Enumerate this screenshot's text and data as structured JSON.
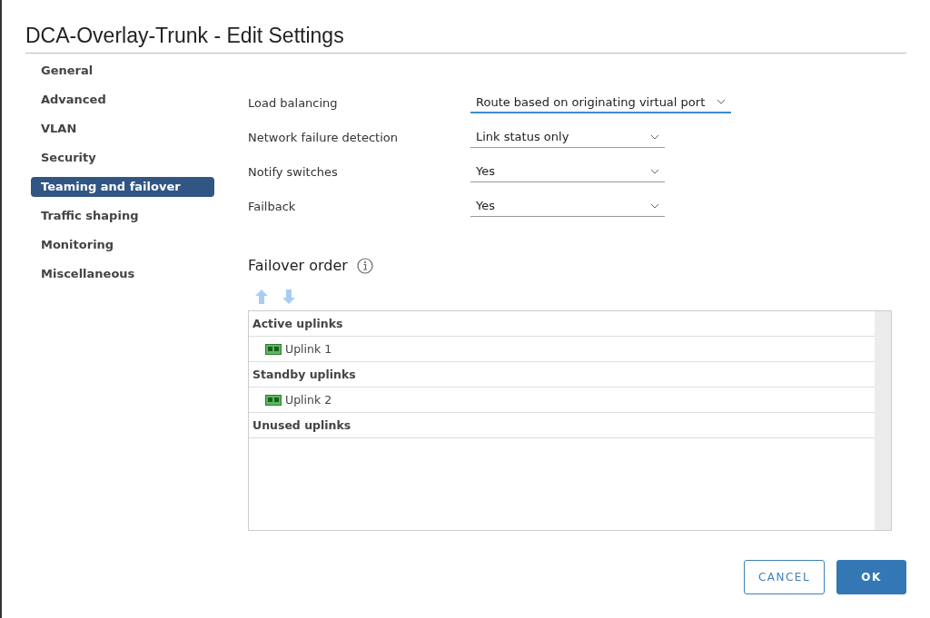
{
  "window": {
    "title": "DCA-Overlay-Trunk - Edit Settings"
  },
  "sidebar": {
    "items": [
      {
        "label": "General",
        "selected": false
      },
      {
        "label": "Advanced",
        "selected": false
      },
      {
        "label": "VLAN",
        "selected": false
      },
      {
        "label": "Security",
        "selected": false
      },
      {
        "label": "Teaming and failover",
        "selected": true
      },
      {
        "label": "Traffic shaping",
        "selected": false
      },
      {
        "label": "Monitoring",
        "selected": false
      },
      {
        "label": "Miscellaneous",
        "selected": false
      }
    ]
  },
  "settings": [
    {
      "label": "Load balancing",
      "value": "Route based on originating virtual port",
      "focused": true
    },
    {
      "label": "Network failure detection",
      "value": "Link status only",
      "focused": false
    },
    {
      "label": "Notify switches",
      "value": "Yes",
      "focused": false
    },
    {
      "label": "Failback",
      "value": "Yes",
      "focused": false
    }
  ],
  "failover_order": {
    "title": "Failover order",
    "groups": [
      {
        "label": "Active uplinks",
        "children": [
          {
            "label": "Uplink 1"
          }
        ]
      },
      {
        "label": "Standby uplinks",
        "children": [
          {
            "label": "Uplink 2"
          }
        ]
      },
      {
        "label": "Unused uplinks"
      }
    ]
  },
  "buttons": [
    {
      "label": "CANCEL",
      "kind": "secondary"
    },
    {
      "label": "OK",
      "kind": "primary"
    }
  ]
}
